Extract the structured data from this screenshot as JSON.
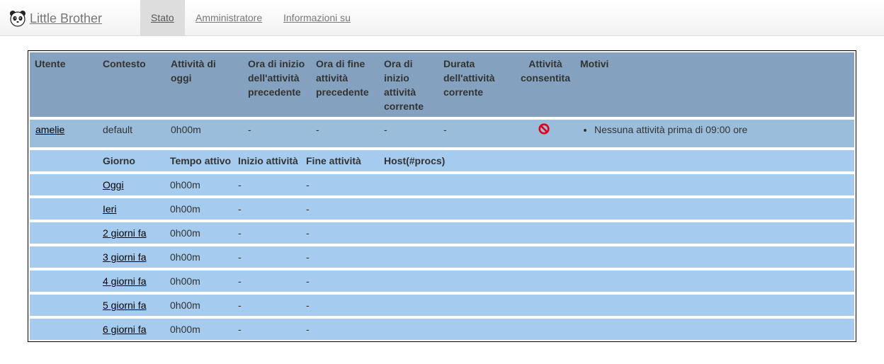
{
  "app": {
    "brand": "Little Brother",
    "nav": [
      {
        "label": "Stato",
        "active": true
      },
      {
        "label": "Amministratore",
        "active": false
      },
      {
        "label": "Informazioni su",
        "active": false
      }
    ]
  },
  "table": {
    "headers": {
      "user": "Utente",
      "context": "Contesto",
      "today_activity": "Attività di oggi",
      "prev_start": "Ora di inizio dell'attività precedente",
      "prev_end": "Ora di fine attività precedente",
      "curr_start": "Ora di inizio attività corrente",
      "curr_duration": "Durata dell'attività corrente",
      "allowed": "Attività consentita",
      "reasons": "Motivi"
    },
    "user_row": {
      "user": "amelie",
      "context": "default",
      "today_activity": "0h00m",
      "prev_start": "-",
      "prev_end": "-",
      "curr_start": "-",
      "curr_duration": "-",
      "allowed_icon": "forbidden-icon",
      "reasons": [
        "Nessuna attività prima di 09:00 ore"
      ]
    },
    "day_headers": {
      "day": "Giorno",
      "active_time": "Tempo attivo",
      "start": "Inizio attività",
      "end": "Fine attività",
      "hosts": "Host(#procs)"
    },
    "days": [
      {
        "day": "Oggi",
        "active_time": "0h00m",
        "start": "-",
        "end": "-"
      },
      {
        "day": "Ieri",
        "active_time": "0h00m",
        "start": "-",
        "end": "-"
      },
      {
        "day": "2 giorni fa",
        "active_time": "0h00m",
        "start": "-",
        "end": "-"
      },
      {
        "day": "3 giorni fa",
        "active_time": "0h00m",
        "start": "-",
        "end": "-"
      },
      {
        "day": "4 giorni fa",
        "active_time": "0h00m",
        "start": "-",
        "end": "-"
      },
      {
        "day": "5 giorni fa",
        "active_time": "0h00m",
        "start": "-",
        "end": "-"
      },
      {
        "day": "6 giorni fa",
        "active_time": "0h00m",
        "start": "-",
        "end": "-"
      }
    ],
    "colors": {
      "header_bg": "#84a2bf",
      "user_row_bg": "#9bbddc",
      "day_row_bg": "#a5ccef",
      "forbidden": "#e0001a"
    }
  }
}
